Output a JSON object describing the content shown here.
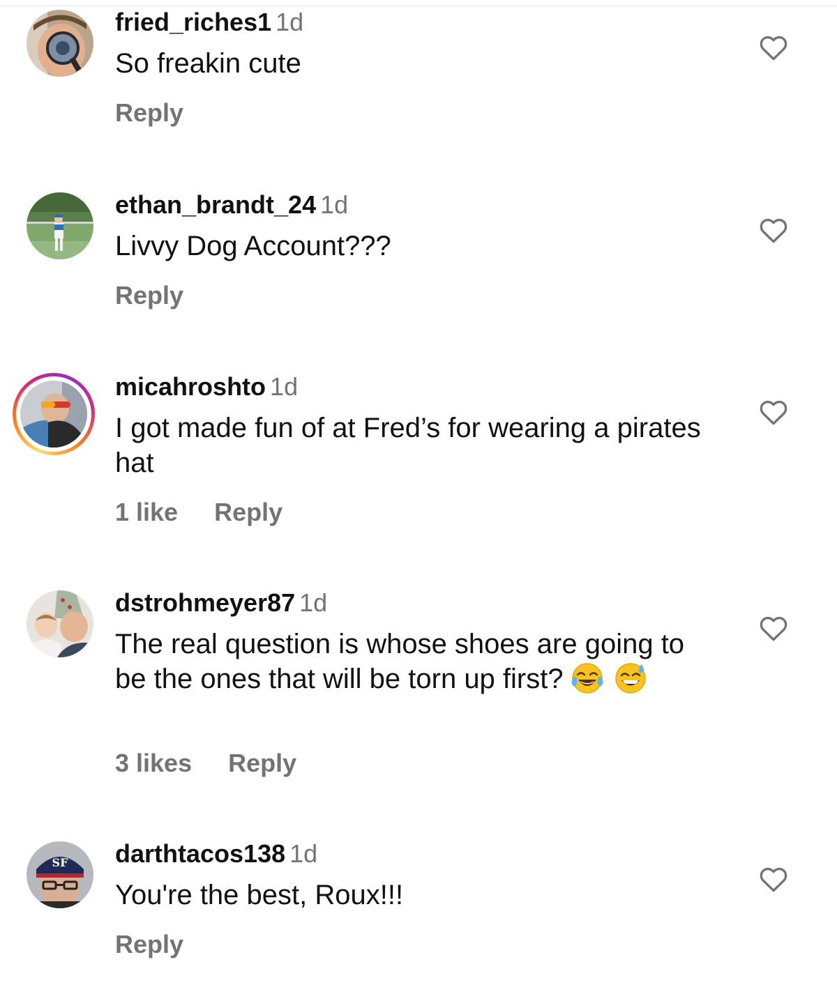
{
  "comments": [
    {
      "username": "fried_riches1",
      "time": "1d",
      "text": "So freakin cute",
      "likes": "",
      "reply": "Reply",
      "emojis": []
    },
    {
      "username": "ethan_brandt_24",
      "time": "1d",
      "text": "Livvy Dog Account???",
      "likes": "",
      "reply": "Reply",
      "emojis": []
    },
    {
      "username": "micahroshto",
      "time": "1d",
      "text": "I got made fun of at Fred’s for wearing a pirates hat",
      "likes": "1 like",
      "reply": "Reply",
      "emojis": []
    },
    {
      "username": "dstrohmeyer87",
      "time": "1d",
      "text": "The real question is whose shoes are going to be the ones that will be torn up first?",
      "likes": "3 likes",
      "reply": "Reply",
      "emojis": [
        "face-with-tears-of-joy-emoji",
        "grinning-face-with-sweat-emoji"
      ]
    },
    {
      "username": "darthtacos138",
      "time": "1d",
      "text": "You're the best, Roux!!!",
      "likes": "",
      "reply": "Reply",
      "emojis": []
    }
  ],
  "colors": {
    "text": "#111111",
    "muted": "#737373",
    "story_ring": [
      "#feda75",
      "#fa7e1e",
      "#d62976",
      "#962fbf"
    ]
  },
  "icons": {
    "like": "heart-outline-icon"
  }
}
